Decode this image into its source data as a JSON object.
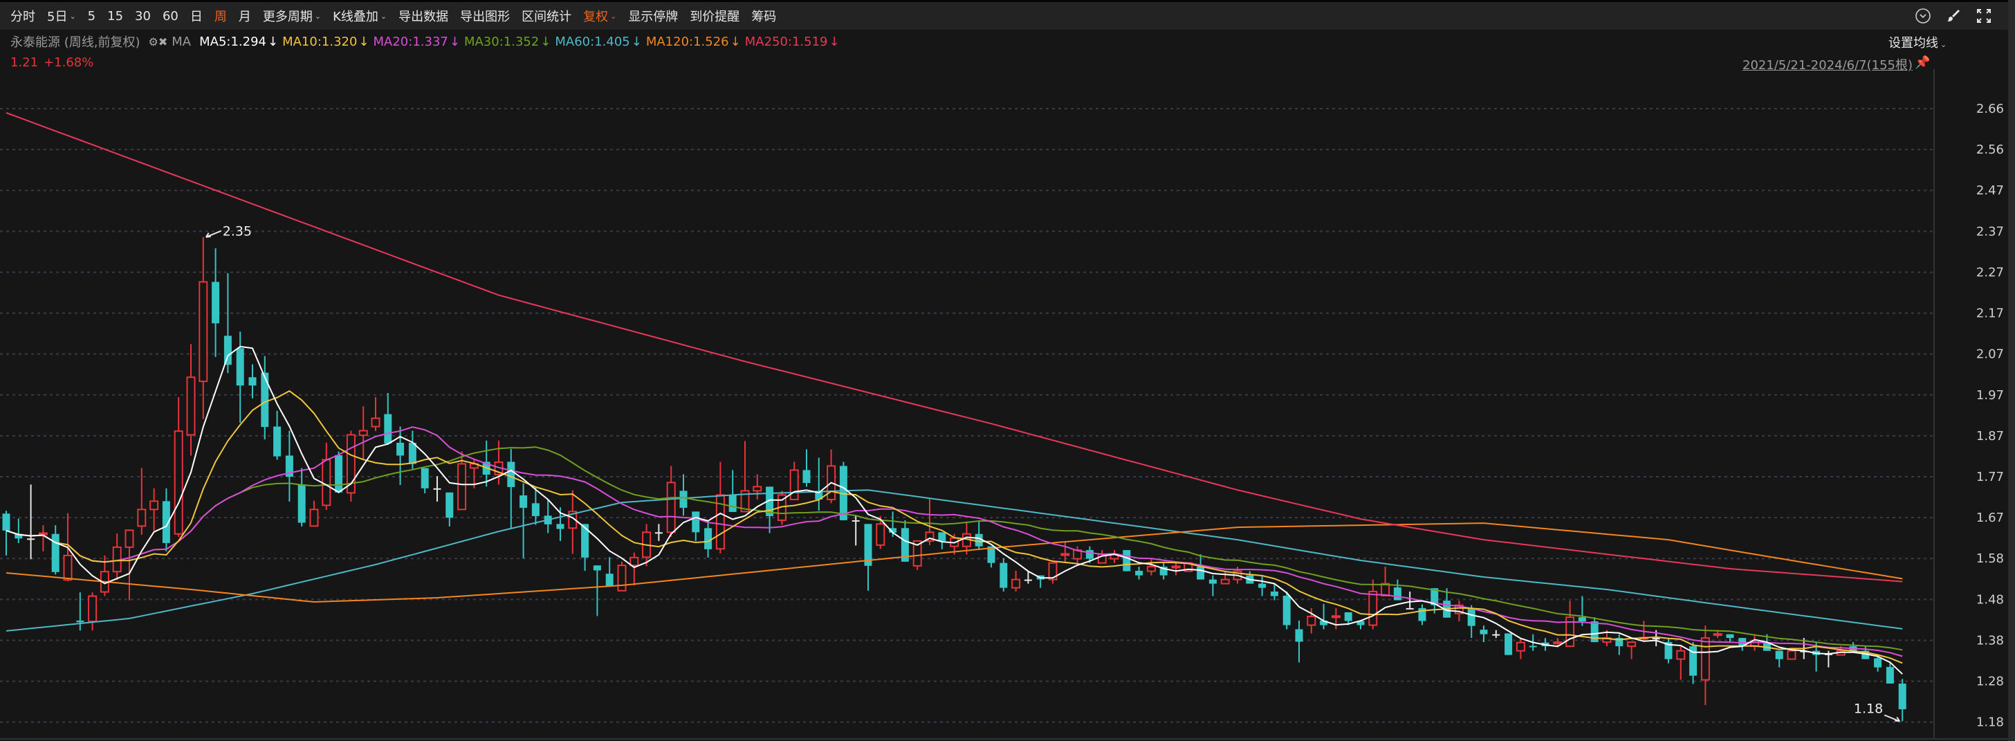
{
  "toolbar": {
    "items": [
      {
        "label": "分时"
      },
      {
        "label": "5日",
        "chevron": true
      },
      {
        "label": "5"
      },
      {
        "label": "15"
      },
      {
        "label": "30"
      },
      {
        "label": "60"
      },
      {
        "label": "日"
      },
      {
        "label": "周",
        "active": true
      },
      {
        "label": "月"
      },
      {
        "label": "更多周期",
        "chevron": true
      },
      {
        "label": "K线叠加",
        "chevron": true
      },
      {
        "label": "导出数据"
      },
      {
        "label": "导出图形"
      },
      {
        "label": "区间统计"
      },
      {
        "label": "复权",
        "active": true,
        "chevron": true
      },
      {
        "label": "显示停牌"
      },
      {
        "label": "到价提醒"
      },
      {
        "label": "筹码"
      }
    ],
    "right_icons": [
      "circle-chevron-down-icon",
      "brush-icon",
      "fullscreen-icon"
    ]
  },
  "info": {
    "stock": "永泰能源 (周线,前复权)",
    "ma_label": "MA",
    "mas": [
      {
        "text": "MA5:1.294",
        "arrow": "↓",
        "color": "#ffffff"
      },
      {
        "text": "MA10:1.320",
        "arrow": "↓",
        "color": "#f0c43c"
      },
      {
        "text": "MA20:1.337",
        "arrow": "↓",
        "color": "#d94fd9"
      },
      {
        "text": "MA30:1.352",
        "arrow": "↓",
        "color": "#6fa020"
      },
      {
        "text": "MA60:1.405",
        "arrow": "↓",
        "color": "#4fb8c8"
      },
      {
        "text": "MA120:1.526",
        "arrow": "↓",
        "color": "#f5861f"
      },
      {
        "text": "MA250:1.519",
        "arrow": "↓",
        "color": "#e8385a"
      }
    ],
    "price": "1.21",
    "change": "+1.68%",
    "set_ma": "设置均线",
    "range": "2021/5/21-2024/6/7(155根)"
  },
  "colors": {
    "up": "#e8343a",
    "down": "#35c5c5",
    "doji": "#e6e6e6",
    "grid": "#3a3a46",
    "bg": "#161616"
  },
  "chart_data": {
    "type": "candlestick",
    "period": "weekly",
    "count": 155,
    "y_ticks": [
      "2.66",
      "2.56",
      "2.47",
      "2.37",
      "2.27",
      "2.17",
      "2.07",
      "1.97",
      "1.87",
      "1.77",
      "1.67",
      "1.58",
      "1.48",
      "1.38",
      "1.28",
      "1.18"
    ],
    "ylim": [
      1.18,
      2.66
    ],
    "max_label": "2.35",
    "min_label": "1.18",
    "ohlc": [
      [
        1.683,
        1.69,
        1.582,
        1.642
      ],
      [
        1.634,
        1.671,
        1.612,
        1.623
      ],
      [
        1.623,
        1.753,
        1.573,
        1.623
      ],
      [
        1.634,
        1.655,
        1.592,
        1.636
      ],
      [
        1.634,
        1.655,
        1.536,
        1.542
      ],
      [
        1.523,
        1.684,
        1.52,
        1.582
      ],
      [
        1.425,
        1.493,
        1.401,
        1.421
      ],
      [
        1.423,
        1.493,
        1.401,
        1.484
      ],
      [
        1.494,
        1.582,
        1.484,
        1.543
      ],
      [
        1.543,
        1.635,
        1.523,
        1.602
      ],
      [
        1.602,
        1.643,
        1.474,
        1.643
      ],
      [
        1.653,
        1.793,
        1.632,
        1.693
      ],
      [
        1.693,
        1.744,
        1.642,
        1.713
      ],
      [
        1.713,
        1.744,
        1.592,
        1.612
      ],
      [
        1.634,
        1.964,
        1.627,
        1.882
      ],
      [
        1.873,
        2.092,
        1.823,
        2.012
      ],
      [
        2.002,
        2.35,
        1.911,
        2.242
      ],
      [
        2.242,
        2.323,
        2.061,
        2.142
      ],
      [
        2.112,
        2.263,
        2.022,
        2.042
      ],
      [
        2.082,
        2.122,
        1.902,
        1.992
      ],
      [
        2.012,
        2.043,
        1.961,
        1.992
      ],
      [
        2.023,
        2.063,
        1.862,
        1.892
      ],
      [
        1.893,
        1.931,
        1.813,
        1.821
      ],
      [
        1.823,
        1.883,
        1.712,
        1.772
      ],
      [
        1.753,
        1.793,
        1.652,
        1.661
      ],
      [
        1.653,
        1.714,
        1.653,
        1.693
      ],
      [
        1.703,
        1.854,
        1.692,
        1.813
      ],
      [
        1.824,
        1.833,
        1.732,
        1.734
      ],
      [
        1.733,
        1.883,
        1.712,
        1.873
      ],
      [
        1.872,
        1.942,
        1.813,
        1.883
      ],
      [
        1.893,
        1.964,
        1.882,
        1.913
      ],
      [
        1.923,
        1.974,
        1.849,
        1.852
      ],
      [
        1.854,
        1.893,
        1.752,
        1.823
      ],
      [
        1.854,
        1.883,
        1.791,
        1.803
      ],
      [
        1.793,
        1.793,
        1.732,
        1.744
      ],
      [
        1.744,
        1.773,
        1.712,
        1.744
      ],
      [
        1.734,
        1.734,
        1.652,
        1.673
      ],
      [
        1.693,
        1.833,
        1.693,
        1.803
      ],
      [
        1.793,
        1.813,
        1.744,
        1.803
      ],
      [
        1.808,
        1.859,
        1.748,
        1.777
      ],
      [
        1.777,
        1.859,
        1.753,
        1.807
      ],
      [
        1.808,
        1.839,
        1.646,
        1.747
      ],
      [
        1.727,
        1.756,
        1.575,
        1.697
      ],
      [
        1.708,
        1.748,
        1.656,
        1.677
      ],
      [
        1.678,
        1.717,
        1.636,
        1.657
      ],
      [
        1.658,
        1.698,
        1.617,
        1.646
      ],
      [
        1.648,
        1.739,
        1.586,
        1.688
      ],
      [
        1.658,
        1.658,
        1.545,
        1.577
      ],
      [
        1.558,
        1.558,
        1.436,
        1.546
      ],
      [
        1.538,
        1.578,
        1.508,
        1.508
      ],
      [
        1.497,
        1.567,
        1.497,
        1.558
      ],
      [
        1.558,
        1.589,
        1.51,
        1.577
      ],
      [
        1.578,
        1.658,
        1.556,
        1.638
      ],
      [
        1.638,
        1.658,
        1.617,
        1.638
      ],
      [
        1.638,
        1.798,
        1.627,
        1.758
      ],
      [
        1.738,
        1.778,
        1.678,
        1.697
      ],
      [
        1.688,
        1.688,
        1.617,
        1.638
      ],
      [
        1.648,
        1.667,
        1.577,
        1.597
      ],
      [
        1.598,
        1.808,
        1.587,
        1.728
      ],
      [
        1.728,
        1.788,
        1.687,
        1.687
      ],
      [
        1.688,
        1.858,
        1.688,
        1.738
      ],
      [
        1.738,
        1.778,
        1.717,
        1.748
      ],
      [
        1.748,
        1.748,
        1.636,
        1.677
      ],
      [
        1.667,
        1.738,
        1.656,
        1.728
      ],
      [
        1.717,
        1.808,
        1.717,
        1.788
      ],
      [
        1.788,
        1.838,
        1.748,
        1.757
      ],
      [
        1.738,
        1.818,
        1.69,
        1.717
      ],
      [
        1.717,
        1.838,
        1.708,
        1.798
      ],
      [
        1.798,
        1.808,
        1.667,
        1.667
      ],
      [
        1.667,
        1.677,
        1.606,
        1.667
      ],
      [
        1.658,
        1.658,
        1.497,
        1.557
      ],
      [
        1.607,
        1.677,
        1.598,
        1.658
      ],
      [
        1.648,
        1.688,
        1.627,
        1.637
      ],
      [
        1.648,
        1.667,
        1.567,
        1.567
      ],
      [
        1.557,
        1.617,
        1.547,
        1.617
      ],
      [
        1.617,
        1.718,
        1.607,
        1.638
      ],
      [
        1.638,
        1.638,
        1.597,
        1.617
      ],
      [
        1.604,
        1.634,
        1.584,
        1.624
      ],
      [
        1.604,
        1.664,
        1.584,
        1.634
      ],
      [
        1.634,
        1.664,
        1.595,
        1.604
      ],
      [
        1.604,
        1.604,
        1.553,
        1.564
      ],
      [
        1.564,
        1.575,
        1.495,
        1.504
      ],
      [
        1.504,
        1.545,
        1.495,
        1.524
      ],
      [
        1.524,
        1.545,
        1.514,
        1.524
      ],
      [
        1.534,
        1.534,
        1.504,
        1.524
      ],
      [
        1.524,
        1.564,
        1.514,
        1.564
      ],
      [
        1.584,
        1.614,
        1.564,
        1.586
      ],
      [
        1.574,
        1.604,
        1.564,
        1.595
      ],
      [
        1.595,
        1.604,
        1.564,
        1.574
      ],
      [
        1.564,
        1.595,
        1.564,
        1.585
      ],
      [
        1.574,
        1.595,
        1.564,
        1.585
      ],
      [
        1.595,
        1.595,
        1.544,
        1.544
      ],
      [
        1.545,
        1.555,
        1.524,
        1.534
      ],
      [
        1.544,
        1.574,
        1.534,
        1.555
      ],
      [
        1.555,
        1.564,
        1.524,
        1.534
      ],
      [
        1.554,
        1.564,
        1.534,
        1.556
      ],
      [
        1.544,
        1.564,
        1.544,
        1.564
      ],
      [
        1.555,
        1.585,
        1.524,
        1.524
      ],
      [
        1.524,
        1.534,
        1.484,
        1.514
      ],
      [
        1.514,
        1.544,
        1.514,
        1.524
      ],
      [
        1.524,
        1.555,
        1.514,
        1.544
      ],
      [
        1.534,
        1.544,
        1.514,
        1.514
      ],
      [
        1.514,
        1.534,
        1.484,
        1.504
      ],
      [
        1.495,
        1.514,
        1.474,
        1.484
      ],
      [
        1.485,
        1.495,
        1.404,
        1.414
      ],
      [
        1.404,
        1.425,
        1.324,
        1.374
      ],
      [
        1.414,
        1.455,
        1.394,
        1.435
      ],
      [
        1.425,
        1.465,
        1.404,
        1.414
      ],
      [
        1.434,
        1.455,
        1.404,
        1.436
      ],
      [
        1.445,
        1.445,
        1.414,
        1.424
      ],
      [
        1.424,
        1.424,
        1.404,
        1.414
      ],
      [
        1.414,
        1.524,
        1.404,
        1.495
      ],
      [
        1.485,
        1.555,
        1.485,
        1.514
      ],
      [
        1.505,
        1.524,
        1.474,
        1.474
      ],
      [
        1.455,
        1.495,
        1.455,
        1.455
      ],
      [
        1.455,
        1.464,
        1.414,
        1.424
      ],
      [
        1.503,
        1.503,
        1.442,
        1.462
      ],
      [
        1.473,
        1.503,
        1.432,
        1.432
      ],
      [
        1.442,
        1.473,
        1.423,
        1.462
      ],
      [
        1.453,
        1.462,
        1.383,
        1.412
      ],
      [
        1.403,
        1.413,
        1.373,
        1.392
      ],
      [
        1.392,
        1.402,
        1.383,
        1.392
      ],
      [
        1.394,
        1.394,
        1.342,
        1.342
      ],
      [
        1.352,
        1.383,
        1.332,
        1.372
      ],
      [
        1.364,
        1.392,
        1.352,
        1.363
      ],
      [
        1.372,
        1.383,
        1.352,
        1.363
      ],
      [
        1.371,
        1.383,
        1.363,
        1.373
      ],
      [
        1.363,
        1.473,
        1.363,
        1.433
      ],
      [
        1.433,
        1.484,
        1.412,
        1.423
      ],
      [
        1.423,
        1.433,
        1.373,
        1.373
      ],
      [
        1.373,
        1.402,
        1.363,
        1.383
      ],
      [
        1.383,
        1.392,
        1.342,
        1.363
      ],
      [
        1.363,
        1.373,
        1.332,
        1.373
      ],
      [
        1.382,
        1.424,
        1.373,
        1.384
      ],
      [
        1.383,
        1.402,
        1.363,
        1.383
      ],
      [
        1.373,
        1.383,
        1.322,
        1.332
      ],
      [
        1.332,
        1.363,
        1.282,
        1.352
      ],
      [
        1.363,
        1.373,
        1.272,
        1.292
      ],
      [
        1.282,
        1.413,
        1.221,
        1.383
      ],
      [
        1.391,
        1.402,
        1.383,
        1.393
      ],
      [
        1.392,
        1.392,
        1.373,
        1.383
      ],
      [
        1.383,
        1.383,
        1.352,
        1.363
      ],
      [
        1.363,
        1.392,
        1.352,
        1.373
      ],
      [
        1.373,
        1.392,
        1.352,
        1.352
      ],
      [
        1.352,
        1.352,
        1.312,
        1.332
      ],
      [
        1.332,
        1.352,
        1.332,
        1.352
      ],
      [
        1.352,
        1.383,
        1.332,
        1.352
      ],
      [
        1.352,
        1.373,
        1.302,
        1.342
      ],
      [
        1.345,
        1.352,
        1.312,
        1.345
      ],
      [
        1.342,
        1.363,
        1.342,
        1.352
      ],
      [
        1.363,
        1.373,
        1.352,
        1.352
      ],
      [
        1.352,
        1.363,
        1.332,
        1.332
      ],
      [
        1.334,
        1.342,
        1.302,
        1.312
      ],
      [
        1.313,
        1.322,
        1.273,
        1.273
      ],
      [
        1.273,
        1.284,
        1.182,
        1.211
      ]
    ],
    "ma_computed": [
      {
        "name": "MA5",
        "period": 5,
        "color": "#ffffff"
      },
      {
        "name": "MA10",
        "period": 10,
        "color": "#f0c43c"
      },
      {
        "name": "MA20",
        "period": 20,
        "color": "#d94fd9"
      },
      {
        "name": "MA30",
        "period": 30,
        "color": "#6fa020"
      }
    ],
    "ma_anchors": [
      {
        "name": "MA60",
        "color": "#4fb8c8",
        "points": [
          [
            0,
            1.4
          ],
          [
            10,
            1.43
          ],
          [
            20,
            1.49
          ],
          [
            30,
            1.56
          ],
          [
            40,
            1.64
          ],
          [
            50,
            1.71
          ],
          [
            60,
            1.73
          ],
          [
            70,
            1.74
          ],
          [
            80,
            1.7
          ],
          [
            90,
            1.66
          ],
          [
            100,
            1.62
          ],
          [
            110,
            1.57
          ],
          [
            120,
            1.53
          ],
          [
            130,
            1.5
          ],
          [
            140,
            1.46
          ],
          [
            154,
            1.405
          ]
        ]
      },
      {
        "name": "MA120",
        "color": "#f5861f",
        "points": [
          [
            0,
            1.54
          ],
          [
            15,
            1.5
          ],
          [
            25,
            1.47
          ],
          [
            35,
            1.48
          ],
          [
            50,
            1.51
          ],
          [
            70,
            1.57
          ],
          [
            80,
            1.6
          ],
          [
            100,
            1.65
          ],
          [
            120,
            1.66
          ],
          [
            135,
            1.62
          ],
          [
            145,
            1.57
          ],
          [
            154,
            1.526
          ]
        ]
      },
      {
        "name": "MA250",
        "color": "#e8385a",
        "points": [
          [
            0,
            2.65
          ],
          [
            20,
            2.43
          ],
          [
            40,
            2.21
          ],
          [
            60,
            2.05
          ],
          [
            80,
            1.9
          ],
          [
            100,
            1.74
          ],
          [
            110,
            1.67
          ],
          [
            120,
            1.62
          ],
          [
            140,
            1.55
          ],
          [
            154,
            1.519
          ]
        ]
      }
    ]
  }
}
